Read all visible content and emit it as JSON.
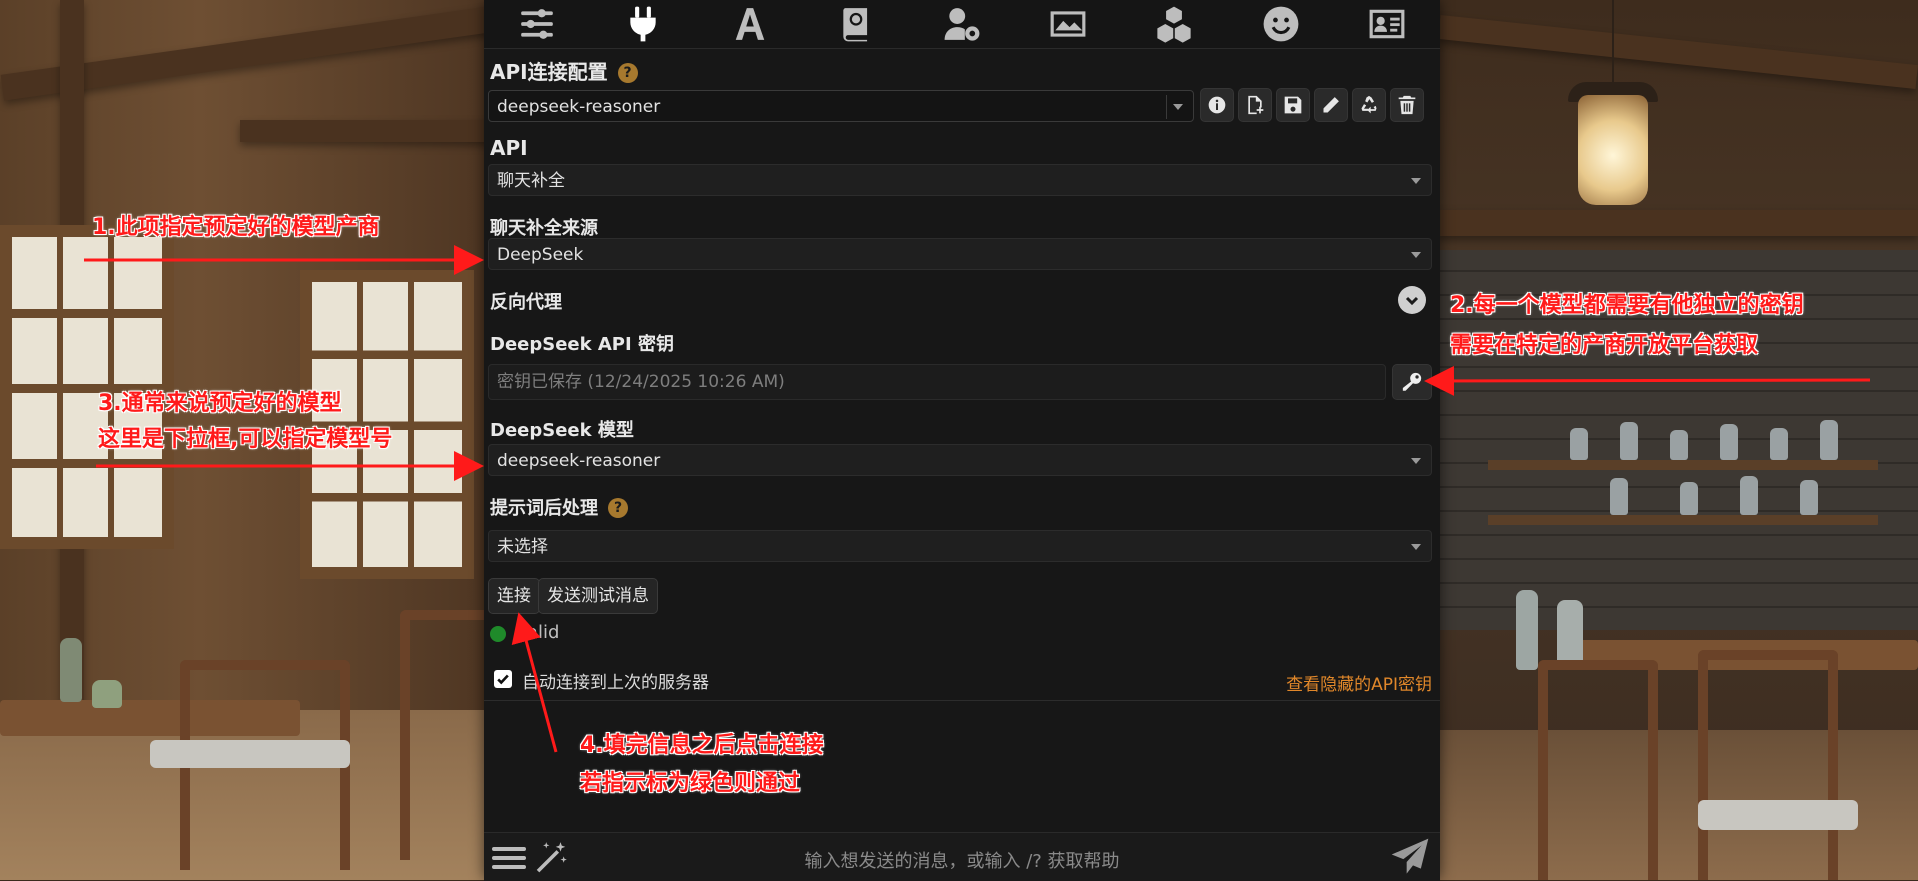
{
  "topbar": {
    "icons": [
      "sliders-icon",
      "plug-icon",
      "font-icon",
      "book-icon",
      "user-cog-icon",
      "image-icon",
      "cubes-icon",
      "smile-icon",
      "id-card-icon"
    ]
  },
  "api_config": {
    "title": "API连接配置",
    "help": "?",
    "selected": "deepseek-reasoner"
  },
  "api": {
    "label": "API",
    "value": "聊天补全"
  },
  "source": {
    "label": "聊天补全来源",
    "value": "DeepSeek"
  },
  "proxy": {
    "label": "反向代理"
  },
  "key": {
    "label": "DeepSeek API 密钥",
    "placeholder": "密钥已保存 (12/24/2025 10:26 AM)"
  },
  "model": {
    "label": "DeepSeek 模型",
    "value": "deepseek-reasoner"
  },
  "postprocess": {
    "label": "提示词后处理",
    "help": "?",
    "value": "未选择"
  },
  "buttons": {
    "connect": "连接",
    "test": "发送测试消息"
  },
  "status": {
    "text": "Valid",
    "color": "#1f8a2a"
  },
  "auto_connect": {
    "label": "自动连接到上次的服务器",
    "checked": true
  },
  "hidden_keys_link": "查看隐藏的API密钥",
  "chat": {
    "placeholder": "输入想发送的消息，或输入 /? 获取帮助"
  },
  "annotations": {
    "a1": "1.此项指定预定好的模型产商",
    "a2_line1": "2.每一个模型都需要有他独立的密钥",
    "a2_line2": "需要在特定的产商开放平台获取",
    "a3_line1": "3.通常来说预定好的模型",
    "a3_line2": "这里是下拉框,可以指定模型号",
    "a4_line1": "4.填完信息之后点击连接",
    "a4_line2": "若指示标为绿色则通过"
  },
  "colors": {
    "panel": "#171717",
    "accent_link": "#e0872a",
    "help_badge": "#a7792e",
    "annotation": "#ff1a1a"
  }
}
